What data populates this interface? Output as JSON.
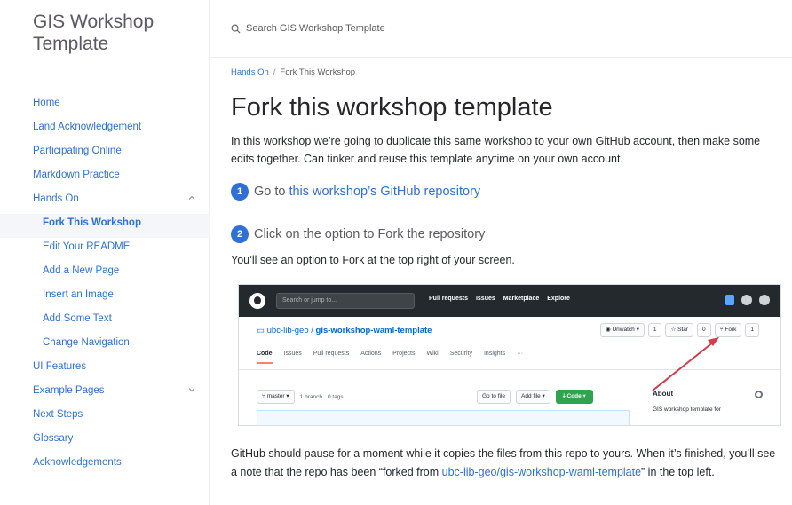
{
  "site": {
    "title": "GIS Workshop Template"
  },
  "search": {
    "placeholder": "Search GIS Workshop Template"
  },
  "nav": {
    "items": [
      {
        "label": "Home",
        "level": "top"
      },
      {
        "label": "Land Acknowledgement",
        "level": "top"
      },
      {
        "label": "Participating Online",
        "level": "top"
      },
      {
        "label": "Markdown Practice",
        "level": "top"
      },
      {
        "label": "Hands On",
        "level": "top",
        "expanded": true
      },
      {
        "label": "Fork This Workshop",
        "level": "sub",
        "active": true
      },
      {
        "label": "Edit Your README",
        "level": "sub"
      },
      {
        "label": "Add a New Page",
        "level": "sub"
      },
      {
        "label": "Insert an Image",
        "level": "sub"
      },
      {
        "label": "Add Some Text",
        "level": "sub"
      },
      {
        "label": "Change Navigation",
        "level": "sub"
      },
      {
        "label": "UI Features",
        "level": "top"
      },
      {
        "label": "Example Pages",
        "level": "top",
        "expanded": false
      },
      {
        "label": "Next Steps",
        "level": "top"
      },
      {
        "label": "Glossary",
        "level": "top"
      },
      {
        "label": "Acknowledgements",
        "level": "top"
      }
    ]
  },
  "breadcrumb": {
    "parent": "Hands On",
    "separator": "/",
    "current": "Fork This Workshop"
  },
  "content": {
    "title": "Fork this workshop template",
    "intro": "In this workshop we’re going to duplicate this same workshop to your own GitHub account, then make some edits together. Can tinker and reuse this template anytime on your own account.",
    "step1": {
      "number": "1",
      "prefix": "Go to",
      "link": "this workshop’s GitHub repository"
    },
    "step2": {
      "number": "2",
      "text": "Click on the option to Fork the repository"
    },
    "note": "You’ll see an option to Fork at the top right of your screen.",
    "closing_before": "GitHub should pause for a moment while it copies the files from this repo to yours. When it’s finished, you’ll see a note that the repo has been “forked from ",
    "closing_link": "ubc-lib-geo/gis-workshop-waml-template",
    "closing_after": "” in the top left."
  },
  "github_screenshot": {
    "search": "Search or jump to...",
    "nav": [
      "Pull requests",
      "Issues",
      "Marketplace",
      "Explore"
    ],
    "owner": "ubc-lib-geo",
    "repo": "gis-workshop-waml-template",
    "watch": "Unwatch",
    "watch_count": "1",
    "star": "Star",
    "star_count": "0",
    "fork": "Fork",
    "fork_count": "1",
    "tabs": [
      "Code",
      "Issues",
      "Pull requests",
      "Actions",
      "Projects",
      "Wiki",
      "Security",
      "Insights"
    ],
    "more": "···",
    "branch": "master",
    "branch_count": "1 branch",
    "tags": "0 tags",
    "goto_file": "Go to file",
    "add_file": "Add file",
    "code": "Code",
    "about_title": "About",
    "about_desc": "GIS workshop template for",
    "arrow_color": "#d73a49"
  },
  "colors": {
    "link": "#2e70d6",
    "github_header": "#24292e",
    "code_button": "#2ea44f"
  }
}
